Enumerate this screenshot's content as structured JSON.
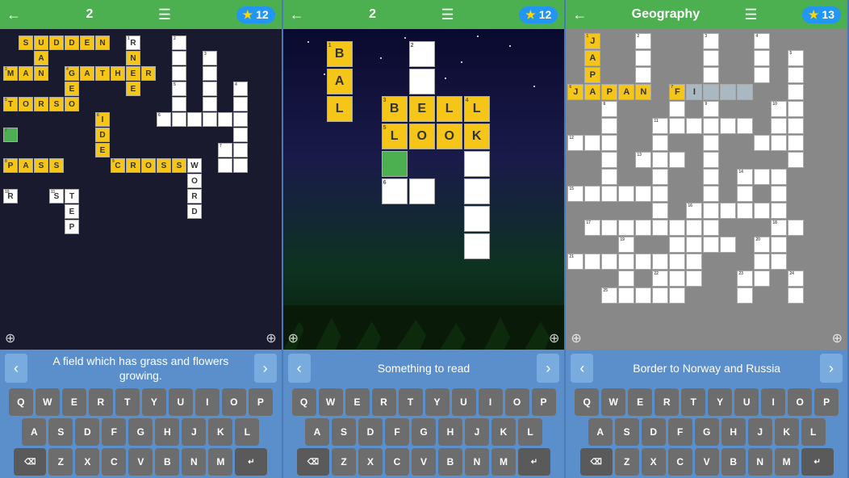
{
  "panels": [
    {
      "id": "panel1",
      "header": {
        "back_label": "←",
        "level_num": "2",
        "list_icon": "☰",
        "score": "12",
        "star": "★"
      },
      "clue": "A field which has grass and flowers growing.",
      "keyboard_rows": [
        [
          "Q",
          "W",
          "E",
          "R",
          "T",
          "Y",
          "U",
          "I",
          "O",
          "P"
        ],
        [
          "A",
          "S",
          "D",
          "F",
          "G",
          "H",
          "J",
          "K",
          "L"
        ],
        [
          "⌫",
          "Z",
          "X",
          "C",
          "V",
          "B",
          "N",
          "M",
          "↵"
        ]
      ],
      "zoom_icon": "⊕"
    },
    {
      "id": "panel2",
      "header": {
        "back_label": "←",
        "level_num": "2",
        "list_icon": "☰",
        "score": "12",
        "star": "★"
      },
      "clue": "Something to read",
      "keyboard_rows": [
        [
          "Q",
          "W",
          "E",
          "R",
          "T",
          "Y",
          "U",
          "I",
          "O",
          "P"
        ],
        [
          "A",
          "S",
          "D",
          "F",
          "G",
          "H",
          "J",
          "K",
          "L"
        ],
        [
          "⌫",
          "Z",
          "X",
          "C",
          "V",
          "B",
          "N",
          "M",
          "↵"
        ]
      ],
      "zoom_icon": "⊕"
    },
    {
      "id": "panel3",
      "header": {
        "back_label": "←",
        "level_num": "Geography",
        "list_icon": "☰",
        "score": "13",
        "star": "★"
      },
      "clue": "Border to Norway and Russia",
      "keyboard_rows": [
        [
          "Q",
          "W",
          "E",
          "R",
          "T",
          "Y",
          "U",
          "I",
          "O",
          "P"
        ],
        [
          "A",
          "S",
          "D",
          "F",
          "G",
          "H",
          "J",
          "K",
          "L"
        ],
        [
          "⌫",
          "Z",
          "X",
          "C",
          "V",
          "B",
          "N",
          "M",
          "↵"
        ]
      ],
      "zoom_icon": "⊕"
    }
  ],
  "colors": {
    "header_green": "#4CAF50",
    "score_blue": "#2196F3",
    "star_yellow": "#FFD700",
    "bg_blue": "#5b8fcc",
    "nav_btn": "#7aabdf",
    "key_bg": "#6d6d6d",
    "cell_yellow": "#f5c518",
    "cell_green": "#4CAF50"
  }
}
